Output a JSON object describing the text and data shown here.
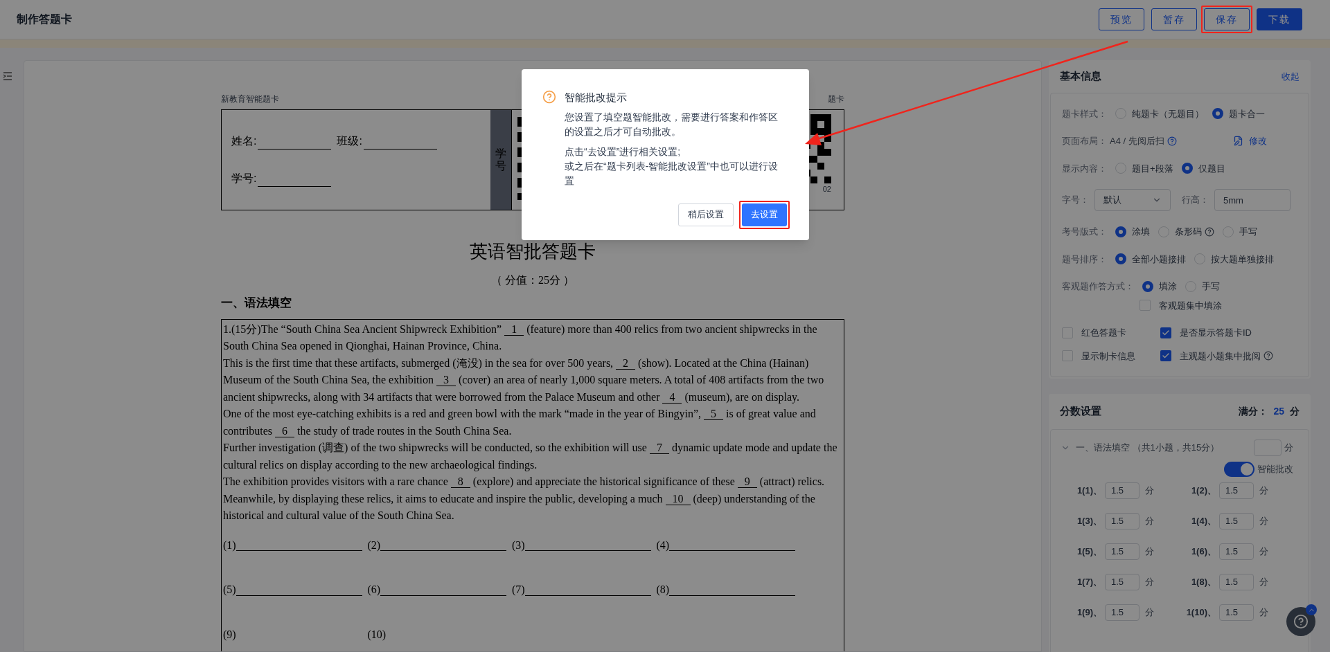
{
  "header": {
    "title": "制作答题卡",
    "buttons": [
      {
        "label": "预览",
        "kind": "outline",
        "highlighted": false
      },
      {
        "label": "暂存",
        "kind": "outline",
        "highlighted": false
      },
      {
        "label": "保存",
        "kind": "outline",
        "highlighted": true
      },
      {
        "label": "下载",
        "kind": "primary",
        "highlighted": false
      }
    ]
  },
  "document": {
    "brand": "新教育智能题卡",
    "brand_right": "题卡",
    "fields": [
      "姓名:",
      "班级:",
      "学号:"
    ],
    "id_label": "学号",
    "id_number": "02",
    "title": "英语智批答题卡",
    "score": "（ 分值：25分 ）",
    "section": "一、语法填空",
    "paragraphs": [
      {
        "parts": [
          "1.(15分)The “South China Sea Ancient Shipwreck Exhibition” ",
          "1",
          " (feature) more than 400 relics from two ancient shipwrecks in the South China Sea opened in Qionghai, Hainan Province, China."
        ]
      },
      {
        "parts": [
          "This is the first time that these artifacts, submerged (淹没) in the sea for over 500 years, ",
          "2",
          " (show). Located at the China (Hainan) Museum of the South China Sea, the exhibition ",
          "3",
          " (cover) an area of nearly 1,000 square meters. A total of 408 artifacts from the two ancient shipwrecks, along with 34 artifacts that were borrowed from the Palace Museum and other ",
          "4",
          " (museum), are on display."
        ]
      },
      {
        "parts": [
          "One of the most eye-catching exhibits is a red and green bowl with the mark “made in the year of Bingyin”, ",
          "5",
          " is of great value and contributes ",
          "6",
          " the study of trade routes in the South China Sea."
        ]
      },
      {
        "parts": [
          "Further investigation (调查) of the two shipwrecks will be conducted, so the exhibition will use ",
          "7",
          " dynamic update mode and update the cultural relics on display according to the new archaeological findings."
        ]
      },
      {
        "parts": [
          "The exhibition provides visitors with a rare chance ",
          "8",
          " (explore) and appreciate the historical significance of these ",
          "9",
          " (attract) relics. Meanwhile, by displaying these relics, it aims to educate and inspire the public, developing a much ",
          "10",
          " (deep) understanding of the historical and cultural value of the South China Sea."
        ]
      }
    ],
    "answers": [
      {
        "label": "(1)",
        "line": true
      },
      {
        "label": "(2)",
        "line": true
      },
      {
        "label": "(3)",
        "line": true
      },
      {
        "label": "(4)",
        "line": true
      },
      {
        "label": "(5)",
        "line": true
      },
      {
        "label": "(6)",
        "line": true
      },
      {
        "label": "(7)",
        "line": true
      },
      {
        "label": "(8)",
        "line": true
      },
      {
        "label": "(9)",
        "line": false
      },
      {
        "label": "(10)",
        "line": false
      }
    ]
  },
  "settings": {
    "title": "基本信息",
    "collapse": "收起",
    "rows": [
      {
        "kind": "radio",
        "label": "题卡样式：",
        "options": [
          {
            "label": "纯题卡（无题目）",
            "selected": false,
            "help": false
          },
          {
            "label": "题卡合一",
            "selected": true,
            "help": false
          }
        ]
      },
      {
        "kind": "info",
        "label": "页面布局：",
        "value": "A4 / 先阅后扫",
        "action": "修改"
      },
      {
        "kind": "radio",
        "label": "显示内容：",
        "options": [
          {
            "label": "题目+段落",
            "selected": false,
            "help": false
          },
          {
            "label": "仅题目",
            "selected": true,
            "help": false
          }
        ]
      },
      {
        "kind": "fields",
        "label": "字号：",
        "select": "默认",
        "label_2": "行高：",
        "value": "5mm"
      },
      {
        "kind": "radio",
        "label": "考号版式：",
        "options": [
          {
            "label": "涂填",
            "selected": true,
            "help": false
          },
          {
            "label": "条形码",
            "selected": false,
            "help": true
          },
          {
            "label": "手写",
            "selected": false,
            "help": false
          }
        ]
      },
      {
        "kind": "radio",
        "label": "题号排序：",
        "options": [
          {
            "label": "全部小题接排",
            "selected": true,
            "help": false
          },
          {
            "label": "按大题单独接排",
            "selected": false,
            "help": false
          }
        ]
      },
      {
        "kind": "radio",
        "label": "客观题作答方式：",
        "options": [
          {
            "label": "填涂",
            "selected": true,
            "help": false
          },
          {
            "label": "手写",
            "selected": false,
            "help": false
          }
        ],
        "check": {
          "label": "客观题集中填涂",
          "checked": false
        }
      }
    ],
    "checkboxes": [
      {
        "label": "红色答题卡",
        "checked": false,
        "help": false
      },
      {
        "label": "是否显示答题卡ID",
        "checked": true,
        "help": false
      },
      {
        "label": "显示制卡信息",
        "checked": false,
        "help": false
      },
      {
        "label": "主观题小题集中批阅",
        "checked": true,
        "help": true
      }
    ]
  },
  "score": {
    "title": "分数设置",
    "total_label": "满分：",
    "total": "25",
    "unit": "分",
    "section": {
      "title": "一、语法填空 （共1小题，共15分）",
      "expanded": true,
      "unit": "分",
      "smart": {
        "label": "智能批改",
        "on": true
      },
      "items": [
        {
          "label": "1(1)、",
          "value": "1.5",
          "unit": "分"
        },
        {
          "label": "1(2)、",
          "value": "1.5",
          "unit": "分"
        },
        {
          "label": "1(3)、",
          "value": "1.5",
          "unit": "分"
        },
        {
          "label": "1(4)、",
          "value": "1.5",
          "unit": "分"
        },
        {
          "label": "1(5)、",
          "value": "1.5",
          "unit": "分"
        },
        {
          "label": "1(6)、",
          "value": "1.5",
          "unit": "分"
        },
        {
          "label": "1(7)、",
          "value": "1.5",
          "unit": "分"
        },
        {
          "label": "1(8)、",
          "value": "1.5",
          "unit": "分"
        },
        {
          "label": "1(9)、",
          "value": "1.5",
          "unit": "分"
        },
        {
          "label": "1(10)、",
          "value": "1.5",
          "unit": "分"
        }
      ]
    }
  },
  "modal": {
    "title": "智能批改提示",
    "message": "您设置了填空题智能批改，需要进行答案和作答区的设置之后才可自动批改。",
    "hints": [
      "点击“去设置”进行相关设置;",
      "或之后在“题卡列表-智能批改设置”中也可以进行设置"
    ],
    "buttons": [
      {
        "label": "稍后设置",
        "kind": "default",
        "highlighted": false
      },
      {
        "label": "去设置",
        "kind": "primary",
        "highlighted": true
      }
    ]
  }
}
